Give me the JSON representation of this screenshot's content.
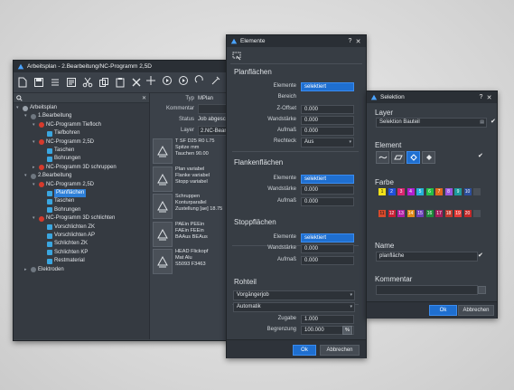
{
  "main": {
    "title": "Arbeitsplan - 2.Bearbeitung/NC-Programm 2,5D",
    "tree": [
      {
        "label": "Arbeitsplan",
        "level": 0,
        "toggle": "▾",
        "icon": "root"
      },
      {
        "label": "1.Bearbeitung",
        "level": 1,
        "toggle": "▾",
        "icon": "gear"
      },
      {
        "label": "NC-Programm Tiefloch",
        "level": 2,
        "toggle": "▾",
        "icon": "nc"
      },
      {
        "label": "Tiefbohren",
        "level": 3,
        "toggle": "",
        "icon": "op"
      },
      {
        "label": "NC-Programm 2,5D",
        "level": 2,
        "toggle": "▾",
        "icon": "nc"
      },
      {
        "label": "Taschen",
        "level": 3,
        "toggle": "",
        "icon": "op"
      },
      {
        "label": "Bohrungen",
        "level": 3,
        "toggle": "",
        "icon": "op"
      },
      {
        "label": "NC-Programm 3D schruppen",
        "level": 2,
        "toggle": "▸",
        "icon": "nc"
      },
      {
        "label": "2.Bearbeitung",
        "level": 1,
        "toggle": "▾",
        "icon": "gear"
      },
      {
        "label": "NC-Programm 2,5D",
        "level": 2,
        "toggle": "▾",
        "icon": "nc"
      },
      {
        "label": "Planflächen",
        "level": 3,
        "toggle": "",
        "icon": "op",
        "selected": true
      },
      {
        "label": "Taschen",
        "level": 3,
        "toggle": "",
        "icon": "op"
      },
      {
        "label": "Bohrungen",
        "level": 3,
        "toggle": "",
        "icon": "op"
      },
      {
        "label": "NC-Programm 3D schlichten",
        "level": 2,
        "toggle": "▾",
        "icon": "nc"
      },
      {
        "label": "Vorschlichten ZK",
        "level": 3,
        "toggle": "",
        "icon": "op"
      },
      {
        "label": "Vorschlichten AP",
        "level": 3,
        "toggle": "",
        "icon": "op"
      },
      {
        "label": "Schlichten ZK",
        "level": 3,
        "toggle": "",
        "icon": "op"
      },
      {
        "label": "Schlichten KP",
        "level": 3,
        "toggle": "",
        "icon": "op"
      },
      {
        "label": "Restmaterial",
        "level": 3,
        "toggle": "",
        "icon": "op"
      },
      {
        "label": "Elektroden",
        "level": 1,
        "toggle": "▸",
        "icon": "gear"
      }
    ],
    "props": {
      "typ_label": "Typ",
      "typ_value": "MPlan",
      "kommentar_label": "Kommentar",
      "kommentar_value": "",
      "status_label": "Status",
      "status_value": "Job abgeschl",
      "layer_label": "Layer",
      "layer_value": "2.NC-Bearbeit"
    },
    "cards": [
      {
        "lines": [
          "T SF D25 R0 L75",
          "Spitze mm",
          "Tauchen 90.00"
        ],
        "icon": "tool-icon"
      },
      {
        "lines": [
          "Plan variabel",
          "Flanke variabel",
          "Stopp variabel"
        ],
        "icon": "plane-icon"
      },
      {
        "lines": [
          "Schruppen",
          "Konturparallel",
          "Zustellung [ae] 18.75"
        ],
        "icon": "layers-icon"
      },
      {
        "lines": [
          "PAEin PEEin",
          "FAEin FEEin",
          "BAAus BEAus"
        ],
        "icon": "approach-icon"
      },
      {
        "lines": [
          "HEAD Flickopf",
          "Mat Alu",
          "S5093 F3463"
        ],
        "icon": "machine-icon"
      }
    ]
  },
  "elemente": {
    "title": "Elemente",
    "help": "?",
    "close": "✕",
    "planflaechen": {
      "heading": "Planflächen",
      "rows": [
        {
          "label": "Elemente",
          "value": "selektiert",
          "blue": true
        },
        {
          "label": "Bereich",
          "value": "",
          "blue": false,
          "empty": true
        },
        {
          "label": "Z-Offset",
          "value": "0.000",
          "blue": false
        },
        {
          "label": "Wandstärke",
          "value": "0.000",
          "blue": false
        },
        {
          "label": "Aufmaß",
          "value": "0.000",
          "blue": false
        }
      ],
      "rechteck_label": "Rechteck",
      "rechteck_value": "Aus"
    },
    "flanken": {
      "heading": "Flankenflächen",
      "rows": [
        {
          "label": "Elemente",
          "value": "selektiert",
          "blue": true
        },
        {
          "label": "Wandstärke",
          "value": "0.000",
          "blue": false
        },
        {
          "label": "Aufmaß",
          "value": "0.000",
          "blue": false
        }
      ]
    },
    "stopp": {
      "heading": "Stoppflächen",
      "rows": [
        {
          "label": "Elemente",
          "value": "selektiert",
          "blue": true
        },
        {
          "label": "Wandstärke",
          "value": "0.000",
          "blue": false
        },
        {
          "label": "Aufmaß",
          "value": "0.000",
          "blue": false
        }
      ]
    },
    "rohteil": {
      "heading": "Rohteil",
      "dropdown1": "Vorgängerjob",
      "dropdown2": "Automatik",
      "zugabe_label": "Zugabe",
      "zugabe_value": "1.000",
      "begrenzung_label": "Begrenzung",
      "begrenzung_value": "100.000",
      "percent": "%"
    },
    "ok": "Ok",
    "cancel": "Abbrechen"
  },
  "selektion": {
    "title": "Selektion",
    "help": "?",
    "close": "✕",
    "layer_heading": "Layer",
    "layer_value": "Selektion Bauteil",
    "element_heading": "Element",
    "farbe_heading": "Farbe",
    "colors_row1": [
      {
        "n": "1",
        "c": "#f2e21a"
      },
      {
        "n": "2",
        "c": "#1f4fd8"
      },
      {
        "n": "3",
        "c": "#d8266e"
      },
      {
        "n": "4",
        "c": "#b21fd0"
      },
      {
        "n": "5",
        "c": "#26b0d8"
      },
      {
        "n": "6",
        "c": "#25c046"
      },
      {
        "n": "7",
        "c": "#e06a1c"
      },
      {
        "n": "8",
        "c": "#9a55e0"
      },
      {
        "n": "9",
        "c": "#1d9c9c"
      },
      {
        "n": "10",
        "c": "#2c4f9e"
      }
    ],
    "colors_row2": [
      {
        "n": "11",
        "c": "#d84a2c"
      },
      {
        "n": "12",
        "c": "#c81f34"
      },
      {
        "n": "13",
        "c": "#b01ea4"
      },
      {
        "n": "14",
        "c": "#e08a1a"
      },
      {
        "n": "15",
        "c": "#6a3fb8"
      },
      {
        "n": "16",
        "c": "#1e8c3a"
      },
      {
        "n": "17",
        "c": "#a31c5c"
      },
      {
        "n": "18",
        "c": "#c0392b"
      },
      {
        "n": "19",
        "c": "#e53935"
      },
      {
        "n": "20",
        "c": "#c62828"
      }
    ],
    "name_heading": "Name",
    "name_value": "planfläche",
    "kommentar_heading": "Kommentar",
    "kommentar_value": "",
    "ok": "Ok",
    "cancel": "Abbrechen"
  }
}
